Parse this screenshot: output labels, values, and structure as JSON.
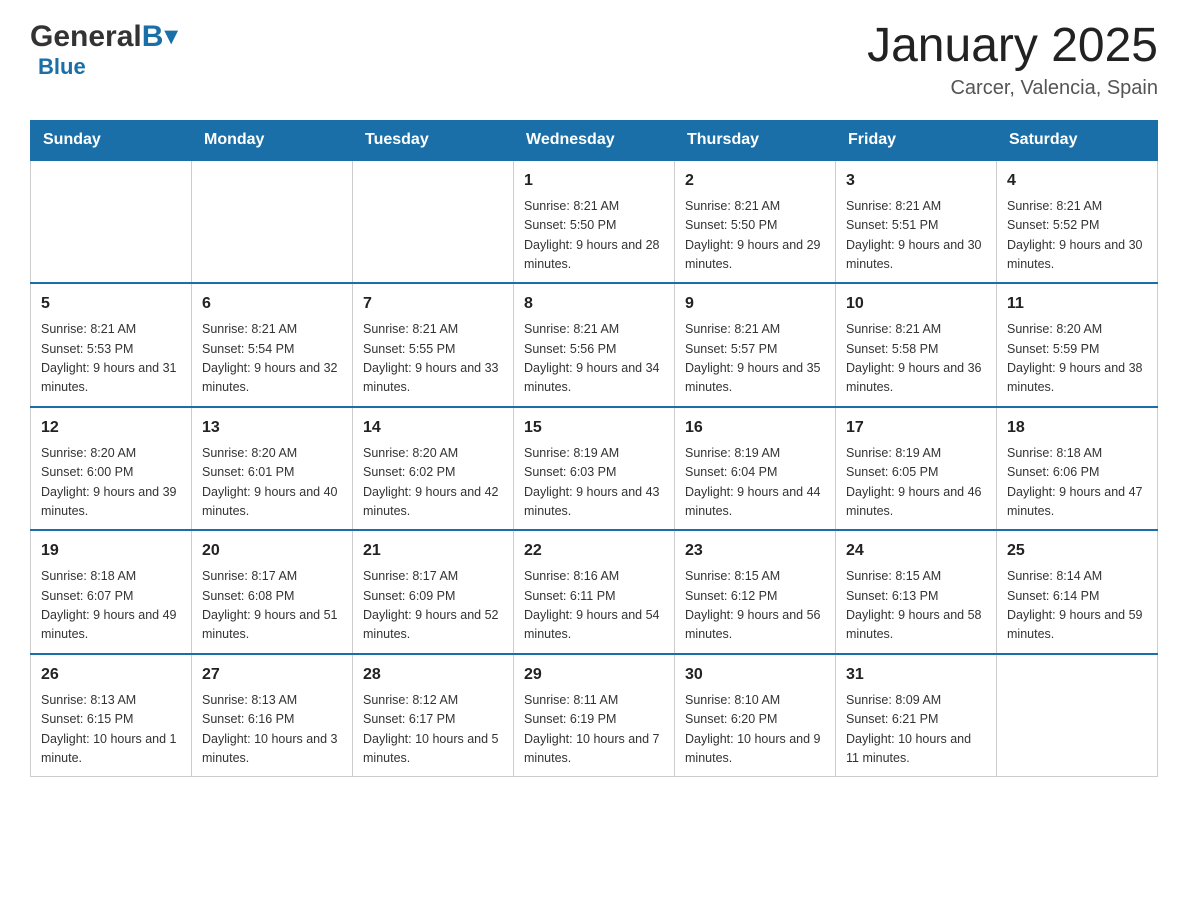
{
  "logo": {
    "general": "General",
    "blue": "Blue",
    "arrow": "▼"
  },
  "header": {
    "month": "January 2025",
    "location": "Carcer, Valencia, Spain"
  },
  "days": {
    "headers": [
      "Sunday",
      "Monday",
      "Tuesday",
      "Wednesday",
      "Thursday",
      "Friday",
      "Saturday"
    ]
  },
  "weeks": [
    {
      "cells": [
        {
          "empty": true
        },
        {
          "empty": true
        },
        {
          "empty": true
        },
        {
          "day": "1",
          "info": "Sunrise: 8:21 AM\nSunset: 5:50 PM\nDaylight: 9 hours and 28 minutes."
        },
        {
          "day": "2",
          "info": "Sunrise: 8:21 AM\nSunset: 5:50 PM\nDaylight: 9 hours and 29 minutes."
        },
        {
          "day": "3",
          "info": "Sunrise: 8:21 AM\nSunset: 5:51 PM\nDaylight: 9 hours and 30 minutes."
        },
        {
          "day": "4",
          "info": "Sunrise: 8:21 AM\nSunset: 5:52 PM\nDaylight: 9 hours and 30 minutes."
        }
      ]
    },
    {
      "cells": [
        {
          "day": "5",
          "info": "Sunrise: 8:21 AM\nSunset: 5:53 PM\nDaylight: 9 hours and 31 minutes."
        },
        {
          "day": "6",
          "info": "Sunrise: 8:21 AM\nSunset: 5:54 PM\nDaylight: 9 hours and 32 minutes."
        },
        {
          "day": "7",
          "info": "Sunrise: 8:21 AM\nSunset: 5:55 PM\nDaylight: 9 hours and 33 minutes."
        },
        {
          "day": "8",
          "info": "Sunrise: 8:21 AM\nSunset: 5:56 PM\nDaylight: 9 hours and 34 minutes."
        },
        {
          "day": "9",
          "info": "Sunrise: 8:21 AM\nSunset: 5:57 PM\nDaylight: 9 hours and 35 minutes."
        },
        {
          "day": "10",
          "info": "Sunrise: 8:21 AM\nSunset: 5:58 PM\nDaylight: 9 hours and 36 minutes."
        },
        {
          "day": "11",
          "info": "Sunrise: 8:20 AM\nSunset: 5:59 PM\nDaylight: 9 hours and 38 minutes."
        }
      ]
    },
    {
      "cells": [
        {
          "day": "12",
          "info": "Sunrise: 8:20 AM\nSunset: 6:00 PM\nDaylight: 9 hours and 39 minutes."
        },
        {
          "day": "13",
          "info": "Sunrise: 8:20 AM\nSunset: 6:01 PM\nDaylight: 9 hours and 40 minutes."
        },
        {
          "day": "14",
          "info": "Sunrise: 8:20 AM\nSunset: 6:02 PM\nDaylight: 9 hours and 42 minutes."
        },
        {
          "day": "15",
          "info": "Sunrise: 8:19 AM\nSunset: 6:03 PM\nDaylight: 9 hours and 43 minutes."
        },
        {
          "day": "16",
          "info": "Sunrise: 8:19 AM\nSunset: 6:04 PM\nDaylight: 9 hours and 44 minutes."
        },
        {
          "day": "17",
          "info": "Sunrise: 8:19 AM\nSunset: 6:05 PM\nDaylight: 9 hours and 46 minutes."
        },
        {
          "day": "18",
          "info": "Sunrise: 8:18 AM\nSunset: 6:06 PM\nDaylight: 9 hours and 47 minutes."
        }
      ]
    },
    {
      "cells": [
        {
          "day": "19",
          "info": "Sunrise: 8:18 AM\nSunset: 6:07 PM\nDaylight: 9 hours and 49 minutes."
        },
        {
          "day": "20",
          "info": "Sunrise: 8:17 AM\nSunset: 6:08 PM\nDaylight: 9 hours and 51 minutes."
        },
        {
          "day": "21",
          "info": "Sunrise: 8:17 AM\nSunset: 6:09 PM\nDaylight: 9 hours and 52 minutes."
        },
        {
          "day": "22",
          "info": "Sunrise: 8:16 AM\nSunset: 6:11 PM\nDaylight: 9 hours and 54 minutes."
        },
        {
          "day": "23",
          "info": "Sunrise: 8:15 AM\nSunset: 6:12 PM\nDaylight: 9 hours and 56 minutes."
        },
        {
          "day": "24",
          "info": "Sunrise: 8:15 AM\nSunset: 6:13 PM\nDaylight: 9 hours and 58 minutes."
        },
        {
          "day": "25",
          "info": "Sunrise: 8:14 AM\nSunset: 6:14 PM\nDaylight: 9 hours and 59 minutes."
        }
      ]
    },
    {
      "cells": [
        {
          "day": "26",
          "info": "Sunrise: 8:13 AM\nSunset: 6:15 PM\nDaylight: 10 hours and 1 minute."
        },
        {
          "day": "27",
          "info": "Sunrise: 8:13 AM\nSunset: 6:16 PM\nDaylight: 10 hours and 3 minutes."
        },
        {
          "day": "28",
          "info": "Sunrise: 8:12 AM\nSunset: 6:17 PM\nDaylight: 10 hours and 5 minutes."
        },
        {
          "day": "29",
          "info": "Sunrise: 8:11 AM\nSunset: 6:19 PM\nDaylight: 10 hours and 7 minutes."
        },
        {
          "day": "30",
          "info": "Sunrise: 8:10 AM\nSunset: 6:20 PM\nDaylight: 10 hours and 9 minutes."
        },
        {
          "day": "31",
          "info": "Sunrise: 8:09 AM\nSunset: 6:21 PM\nDaylight: 10 hours and 11 minutes."
        },
        {
          "empty": true
        }
      ]
    }
  ]
}
